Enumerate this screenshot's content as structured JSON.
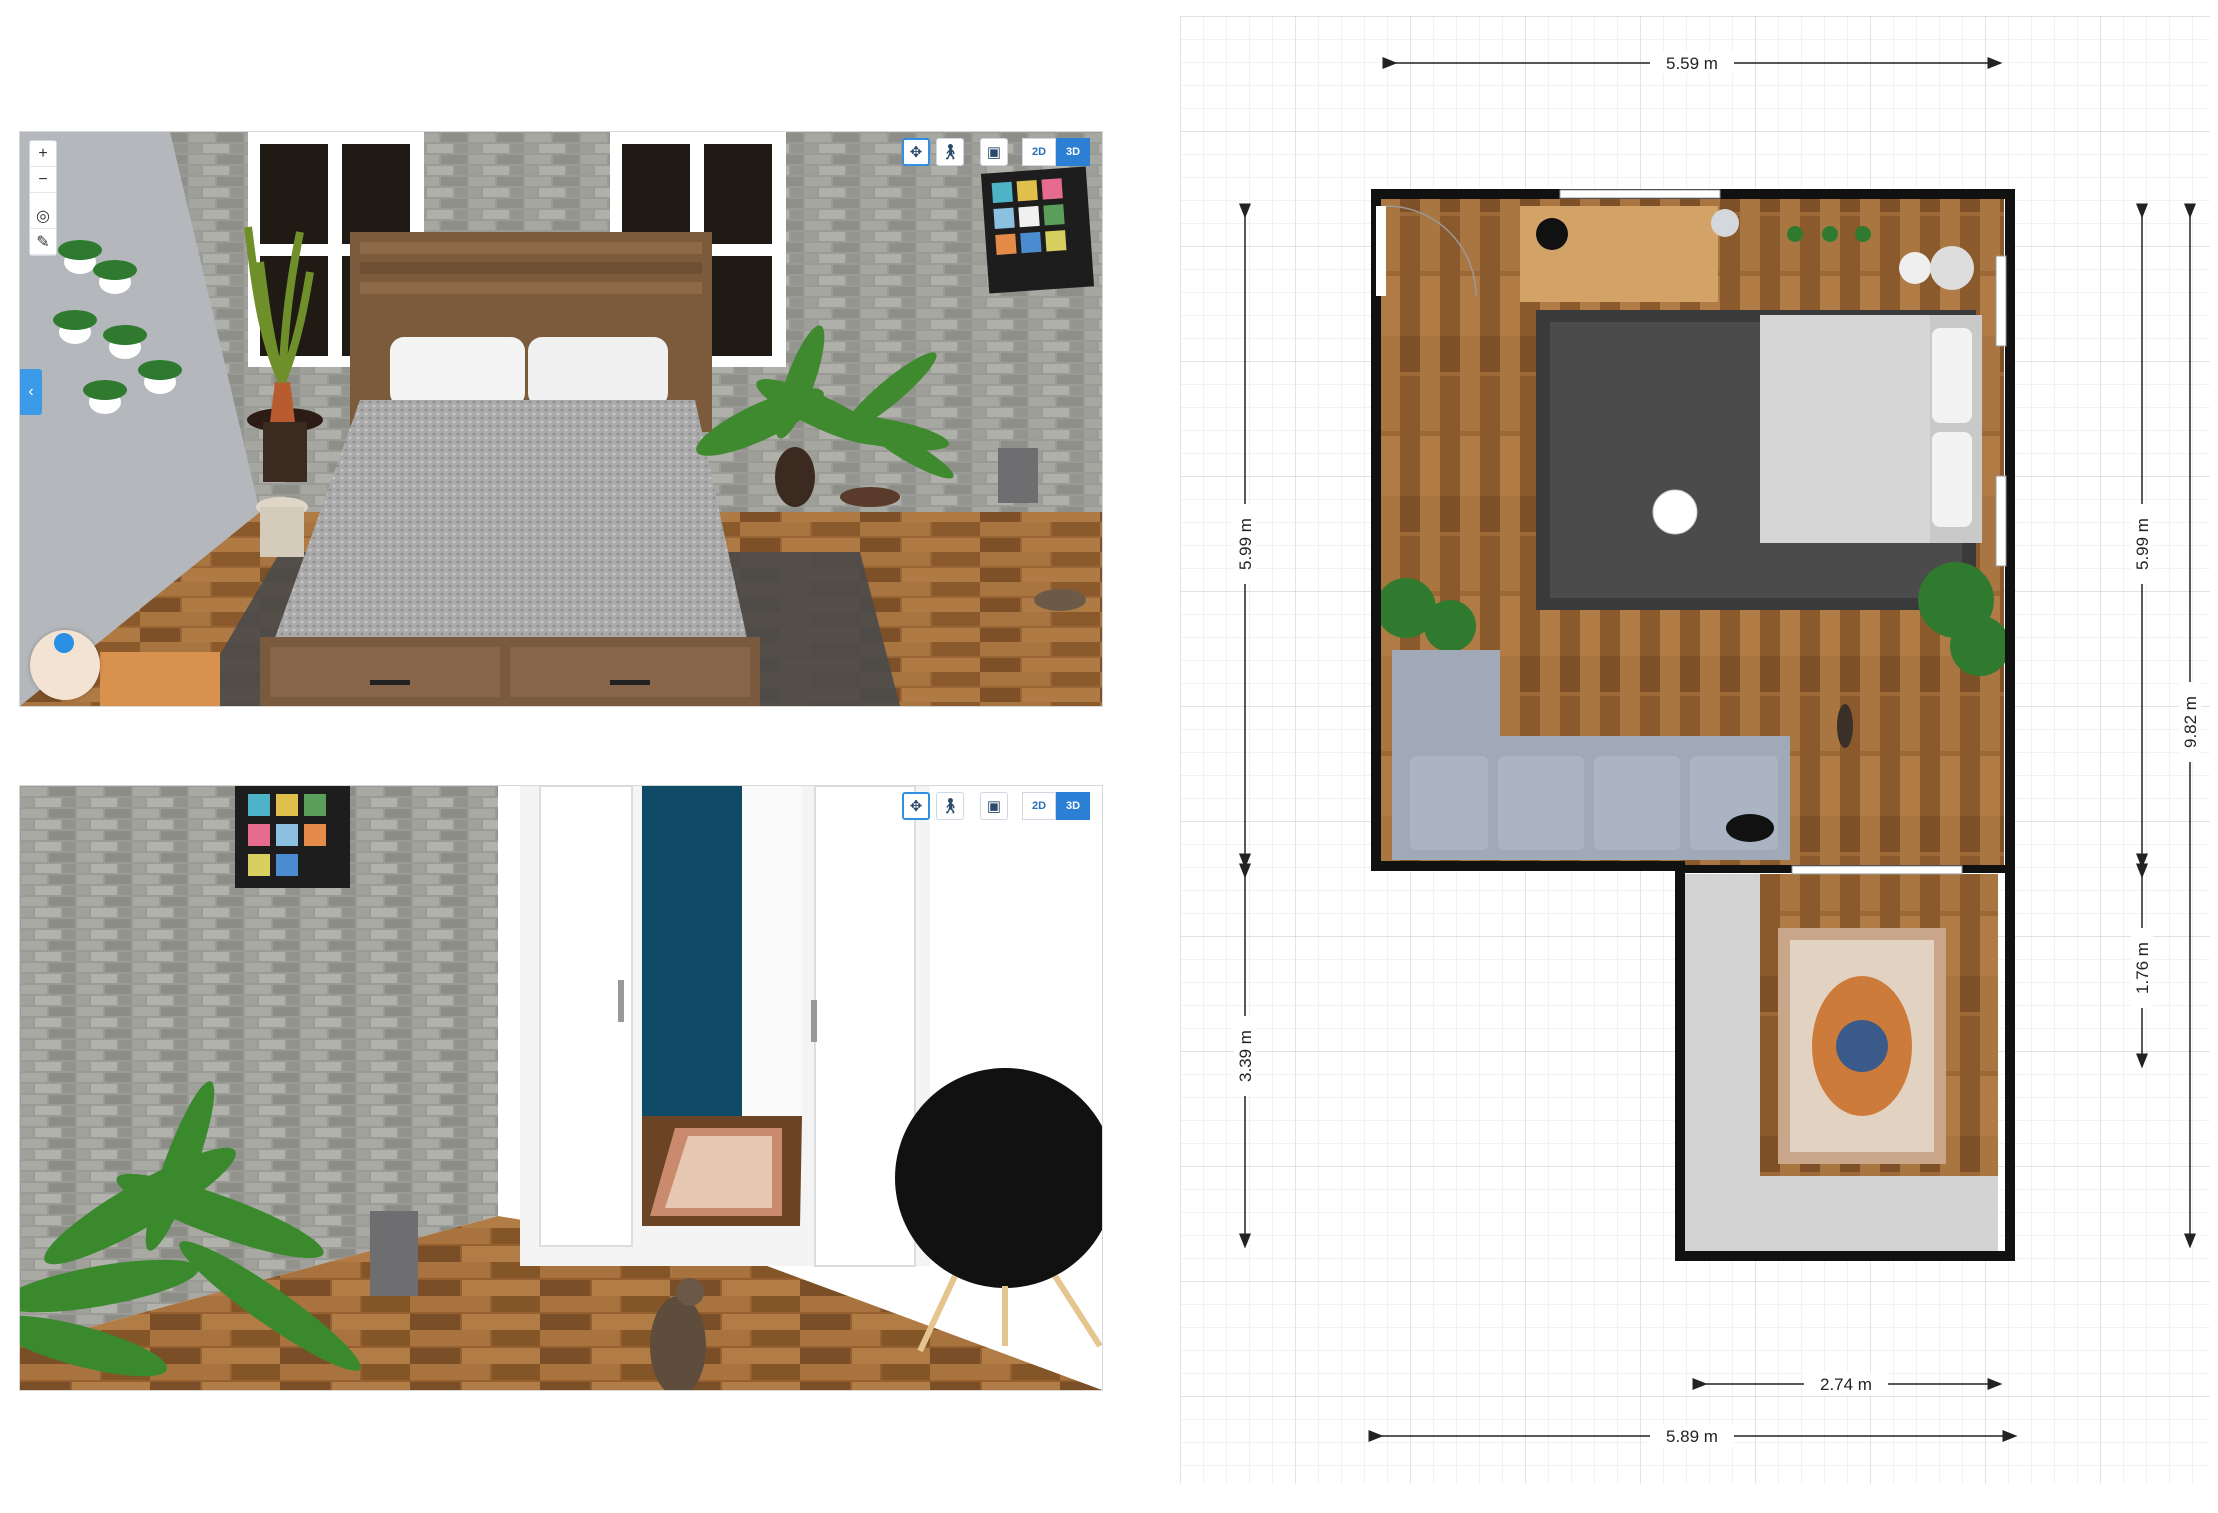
{
  "toolbar": {
    "view_2d": "2D",
    "view_3d": "3D",
    "icons": [
      "orbit-icon",
      "walk-icon",
      "camera-icon"
    ]
  },
  "left_tools": {
    "zoom_in": "+",
    "zoom_out": "−",
    "icons": [
      "zoom-in-icon",
      "zoom-out-icon",
      "locate-icon",
      "pencil-icon"
    ]
  },
  "side_tab": {
    "label": "‹"
  },
  "floor_plan": {
    "dimensions": {
      "top_width": "5.59 m",
      "left_upper_height": "5.99 m",
      "left_lower_height": "3.39 m",
      "right_upper_height": "5.99 m",
      "right_lower_height": "1.76 m",
      "total_height": "9.82 m",
      "closet_width": "2.74 m",
      "bottom_width": "5.89 m"
    }
  },
  "colors": {
    "accent_blue": "#2b7fd4",
    "wall": "#1a1a1a",
    "floor_wood": "#9b6a3a",
    "rug_dark": "#3a3a3a",
    "sofa": "#9aa6b6",
    "grid": "#e4e4e4"
  }
}
